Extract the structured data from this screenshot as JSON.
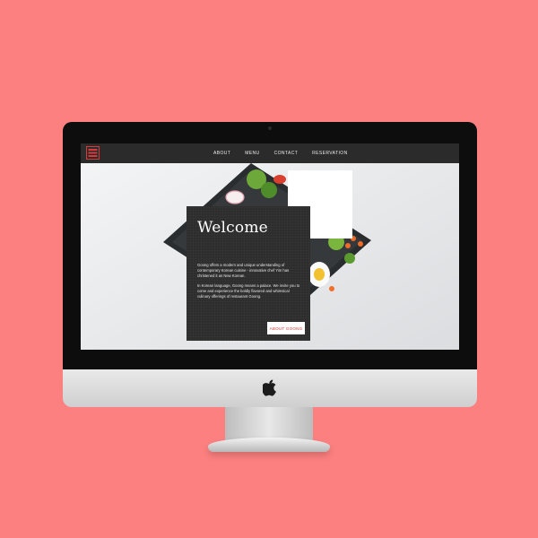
{
  "colors": {
    "background": "#fd8080",
    "navbar": "#2b2b2b",
    "card": "#2d2d2d",
    "accent": "#d83a3a"
  },
  "nav": {
    "logo_icon": "restaurant-logo-icon",
    "items": [
      {
        "label": "ABOUT"
      },
      {
        "label": "MENU"
      },
      {
        "label": "CONTACT"
      },
      {
        "label": "RESERVATION"
      }
    ]
  },
  "welcome": {
    "title": "Welcome",
    "paragraph1": "Goong offers a modern and unique understanding of contemporary Korean cuisine - innovative chef Yim has christened it as New Korean.",
    "paragraph2": "In Korean language, Goong means a palace. We invite you to come and experience the boldly flavored and whimsical culinary offerings of restaurant Goong.",
    "button_label": "ABOUT GOONG"
  },
  "device": {
    "brand_icon": "apple-logo-icon"
  }
}
